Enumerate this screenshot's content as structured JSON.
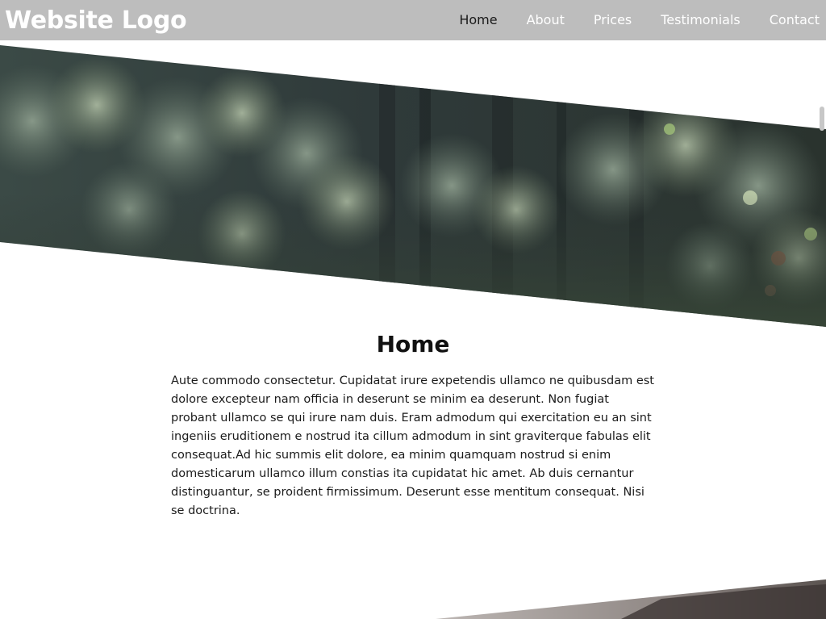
{
  "navbar": {
    "logo": "Website Logo",
    "links": [
      {
        "label": "Home",
        "active": true
      },
      {
        "label": "About",
        "active": false
      },
      {
        "label": "Prices",
        "active": false
      },
      {
        "label": "Testimonials",
        "active": false
      },
      {
        "label": "Contact",
        "active": false
      }
    ]
  },
  "main": {
    "heading": "Home",
    "body": "Aute commodo consectetur. Cupidatat irure expetendis ullamco ne quibusdam est dolore excepteur nam officia in deserunt se minim ea deserunt. Non fugiat probant ullamco se qui irure nam duis. Eram admodum qui exercitation eu an sint ingeniis eruditionem e nostrud ita cillum admodum in sint graviterque fabulas elit consequat.Ad hic summis elit dolore, ea minim quamquam nostrud si enim domesticarum ullamco illum constias ita cupidatat hic amet. Ab duis cernantur distinguantur, se proident firmissimum. Deserunt esse mentitum consequat. Nisi se doctrina."
  },
  "colors": {
    "navbar_bg": "#bdbdbd",
    "nav_text": "#ffffff",
    "nav_active": "#1a1a1a"
  }
}
